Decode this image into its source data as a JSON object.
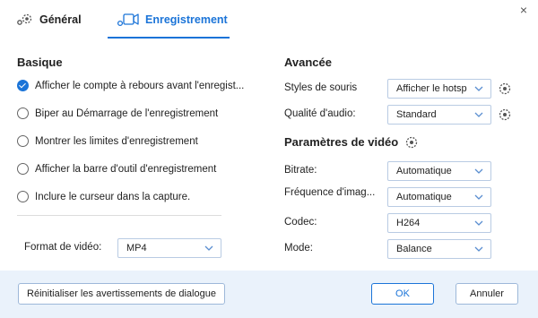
{
  "tabs": [
    {
      "label": "Général",
      "icon": "gear-icon"
    },
    {
      "label": "Enregistrement",
      "icon": "camera-icon",
      "active": true
    }
  ],
  "close_label": "×",
  "basique": {
    "title": "Basique",
    "options": [
      {
        "label": "Afficher le compte à rebours avant l'enregist...",
        "checked": true
      },
      {
        "label": "Biper au Démarrage de l'enregistrement",
        "checked": false
      },
      {
        "label": "Montrer les limites d'enregistrement",
        "checked": false
      },
      {
        "label": "Afficher la barre d'outil d'enregistrement",
        "checked": false
      },
      {
        "label": "Inclure le curseur dans la capture.",
        "checked": false
      }
    ],
    "video_format_label": "Format de vidéo:",
    "video_format_value": "MP4"
  },
  "avancee": {
    "title": "Avancée",
    "mouse_style_label": "Styles de souris",
    "mouse_style_value": "Afficher le hotsp",
    "audio_quality_label": "Qualité d'audio:",
    "audio_quality_value": "Standard"
  },
  "video_params": {
    "title": "Paramètres de vidéo",
    "bitrate_label": "Bitrate:",
    "bitrate_value": "Automatique",
    "framerate_label": "Fréquence d'imag...",
    "framerate_value": "Automatique",
    "codec_label": "Codec:",
    "codec_value": "H264",
    "mode_label": "Mode:",
    "mode_value": "Balance"
  },
  "footer": {
    "reset_label": "Réinitialiser les avertissements de dialogue",
    "ok_label": "OK",
    "cancel_label": "Annuler"
  },
  "colors": {
    "accent": "#1b74d8",
    "footer_bg": "#eaf2fb"
  }
}
